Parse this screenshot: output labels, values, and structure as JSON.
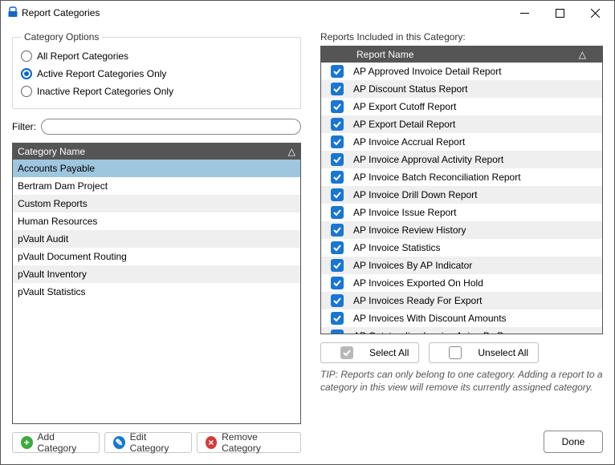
{
  "window": {
    "title": "Report Categories"
  },
  "options": {
    "legend": "Category Options",
    "items": [
      {
        "label": "All Report Categories",
        "selected": false
      },
      {
        "label": "Active Report Categories Only",
        "selected": true
      },
      {
        "label": "Inactive Report Categories Only",
        "selected": false
      }
    ]
  },
  "filter": {
    "label": "Filter:",
    "value": ""
  },
  "category_grid": {
    "header": "Category Name",
    "rows": [
      {
        "name": "Accounts Payable",
        "selected": true
      },
      {
        "name": "Bertram Dam Project",
        "selected": false
      },
      {
        "name": "Custom Reports",
        "selected": false
      },
      {
        "name": "Human Resources",
        "selected": false
      },
      {
        "name": "pVault Audit",
        "selected": false
      },
      {
        "name": "pVault Document Routing",
        "selected": false
      },
      {
        "name": "pVault Inventory",
        "selected": false
      },
      {
        "name": "pVault Statistics",
        "selected": false
      }
    ]
  },
  "cat_buttons": {
    "add": "Add Category",
    "edit": "Edit Category",
    "remove": "Remove Category"
  },
  "reports": {
    "label": "Reports Included in this Category:",
    "header": "Report Name",
    "rows": [
      {
        "name": "AP Approved Invoice Detail Report",
        "checked": true
      },
      {
        "name": "AP Discount Status Report",
        "checked": true
      },
      {
        "name": "AP Export Cutoff Report",
        "checked": true
      },
      {
        "name": "AP Export Detail Report",
        "checked": true
      },
      {
        "name": "AP Invoice Accrual Report",
        "checked": true
      },
      {
        "name": "AP Invoice Approval Activity Report",
        "checked": true
      },
      {
        "name": "AP Invoice Batch Reconciliation Report",
        "checked": true
      },
      {
        "name": "AP Invoice Drill Down Report",
        "checked": true
      },
      {
        "name": "AP Invoice Issue Report",
        "checked": true
      },
      {
        "name": "AP Invoice Review History",
        "checked": true
      },
      {
        "name": "AP Invoice Statistics",
        "checked": true
      },
      {
        "name": "AP Invoices By AP Indicator",
        "checked": true
      },
      {
        "name": "AP Invoices Exported On Hold",
        "checked": true
      },
      {
        "name": "AP Invoices Ready For Export",
        "checked": true
      },
      {
        "name": "AP Invoices With Discount Amounts",
        "checked": true
      },
      {
        "name": "AP Outstanding Invoice Aging By Processor",
        "checked": true
      }
    ],
    "select_all": "Select All",
    "unselect_all": "Unselect All",
    "tip": "TIP:  Reports can only belong to one category.  Adding a report to a category in this view will remove its currently assigned category."
  },
  "footer": {
    "done": "Done"
  },
  "icons": {
    "add": "+",
    "edit": "✎",
    "remove": "×"
  }
}
